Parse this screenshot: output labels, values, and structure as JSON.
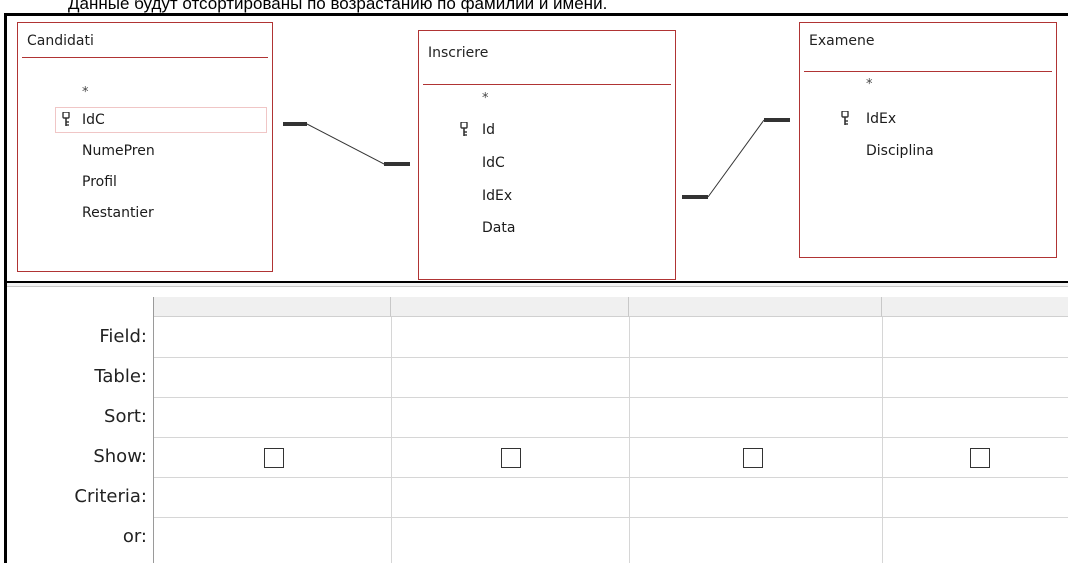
{
  "caption": "Данные будут отсортированы по возрастанию по фамилии и имени.",
  "tables": {
    "candidati": {
      "title": "Candidati",
      "fields": [
        "*",
        "IdC",
        "NumePren",
        "Profil",
        "Restantier"
      ]
    },
    "inscriere": {
      "title": "Inscriere",
      "fields": [
        "*",
        "Id",
        "IdC",
        "IdEx",
        "Data"
      ]
    },
    "examene": {
      "title": "Examene",
      "fields": [
        "*",
        "IdEx",
        "Disciplina"
      ]
    }
  },
  "grid": {
    "row_labels": [
      "Field:",
      "Table:",
      "Sort:",
      "Show:",
      "Criteria:",
      "or:"
    ],
    "columns": [
      {
        "field": "",
        "table": "",
        "sort": "",
        "show": false,
        "criteria": "",
        "or": ""
      },
      {
        "field": "",
        "table": "",
        "sort": "",
        "show": false,
        "criteria": "",
        "or": ""
      },
      {
        "field": "",
        "table": "",
        "sort": "",
        "show": false,
        "criteria": "",
        "or": ""
      },
      {
        "field": "",
        "table": "",
        "sort": "",
        "show": false,
        "criteria": "",
        "or": ""
      }
    ]
  },
  "colors": {
    "table_border": "#b03434",
    "grid_line": "#d6d6d6",
    "header_bg": "#f0f0f0"
  },
  "icons": {
    "primary_key": "key-icon"
  }
}
